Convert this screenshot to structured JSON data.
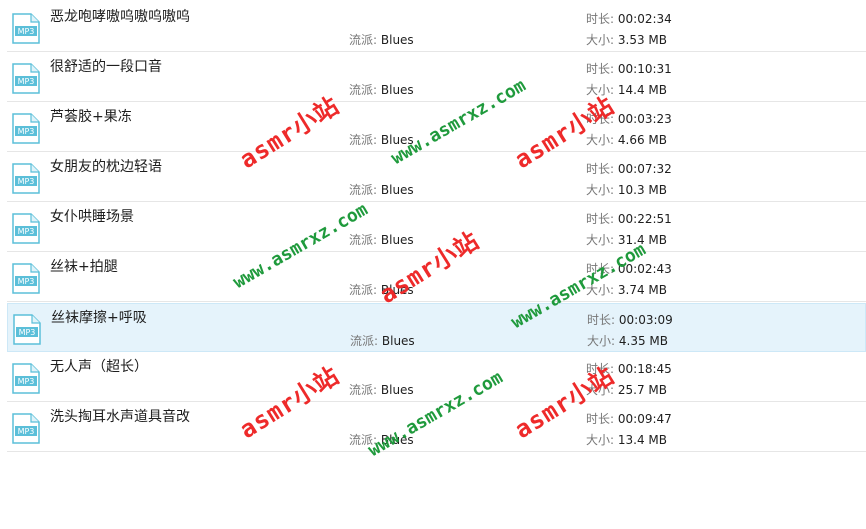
{
  "labels": {
    "genre": "流派:",
    "duration": "时长:",
    "size": "大小:"
  },
  "icon": {
    "name": "mp3-file-icon",
    "text": "MP3",
    "color": "#5bbfd9"
  },
  "colors": {
    "selected_row": "#e5f3fb",
    "watermark_red": "#ee2a2a",
    "watermark_green": "#1f9a3c"
  },
  "files": [
    {
      "title": "恶龙咆哮嗷呜嗷呜嗷呜",
      "genre": "Blues",
      "duration": "00:02:34",
      "size": "3.53 MB",
      "selected": false
    },
    {
      "title": "很舒适的一段口音",
      "genre": "Blues",
      "duration": "00:10:31",
      "size": "14.4 MB",
      "selected": false
    },
    {
      "title": "芦荟胶+果冻",
      "genre": "Blues",
      "duration": "00:03:23",
      "size": "4.66 MB",
      "selected": false
    },
    {
      "title": "女朋友的枕边轻语",
      "genre": "Blues",
      "duration": "00:07:32",
      "size": "10.3 MB",
      "selected": false
    },
    {
      "title": "女仆哄睡场景",
      "genre": "Blues",
      "duration": "00:22:51",
      "size": "31.4 MB",
      "selected": false
    },
    {
      "title": "丝袜+拍腿",
      "genre": "Blues",
      "duration": "00:02:43",
      "size": "3.74 MB",
      "selected": false
    },
    {
      "title": "丝袜摩擦+呼吸",
      "genre": "Blues",
      "duration": "00:03:09",
      "size": "4.35 MB",
      "selected": true
    },
    {
      "title": "无人声（超长）",
      "genre": "Blues",
      "duration": "00:18:45",
      "size": "25.7 MB",
      "selected": false
    },
    {
      "title": "洗头掏耳水声道具音改",
      "genre": "Blues",
      "duration": "00:09:47",
      "size": "13.4 MB",
      "selected": false
    }
  ],
  "watermarks": {
    "red_text": "asmr小站",
    "green_text": "www.asmrxz.com"
  }
}
